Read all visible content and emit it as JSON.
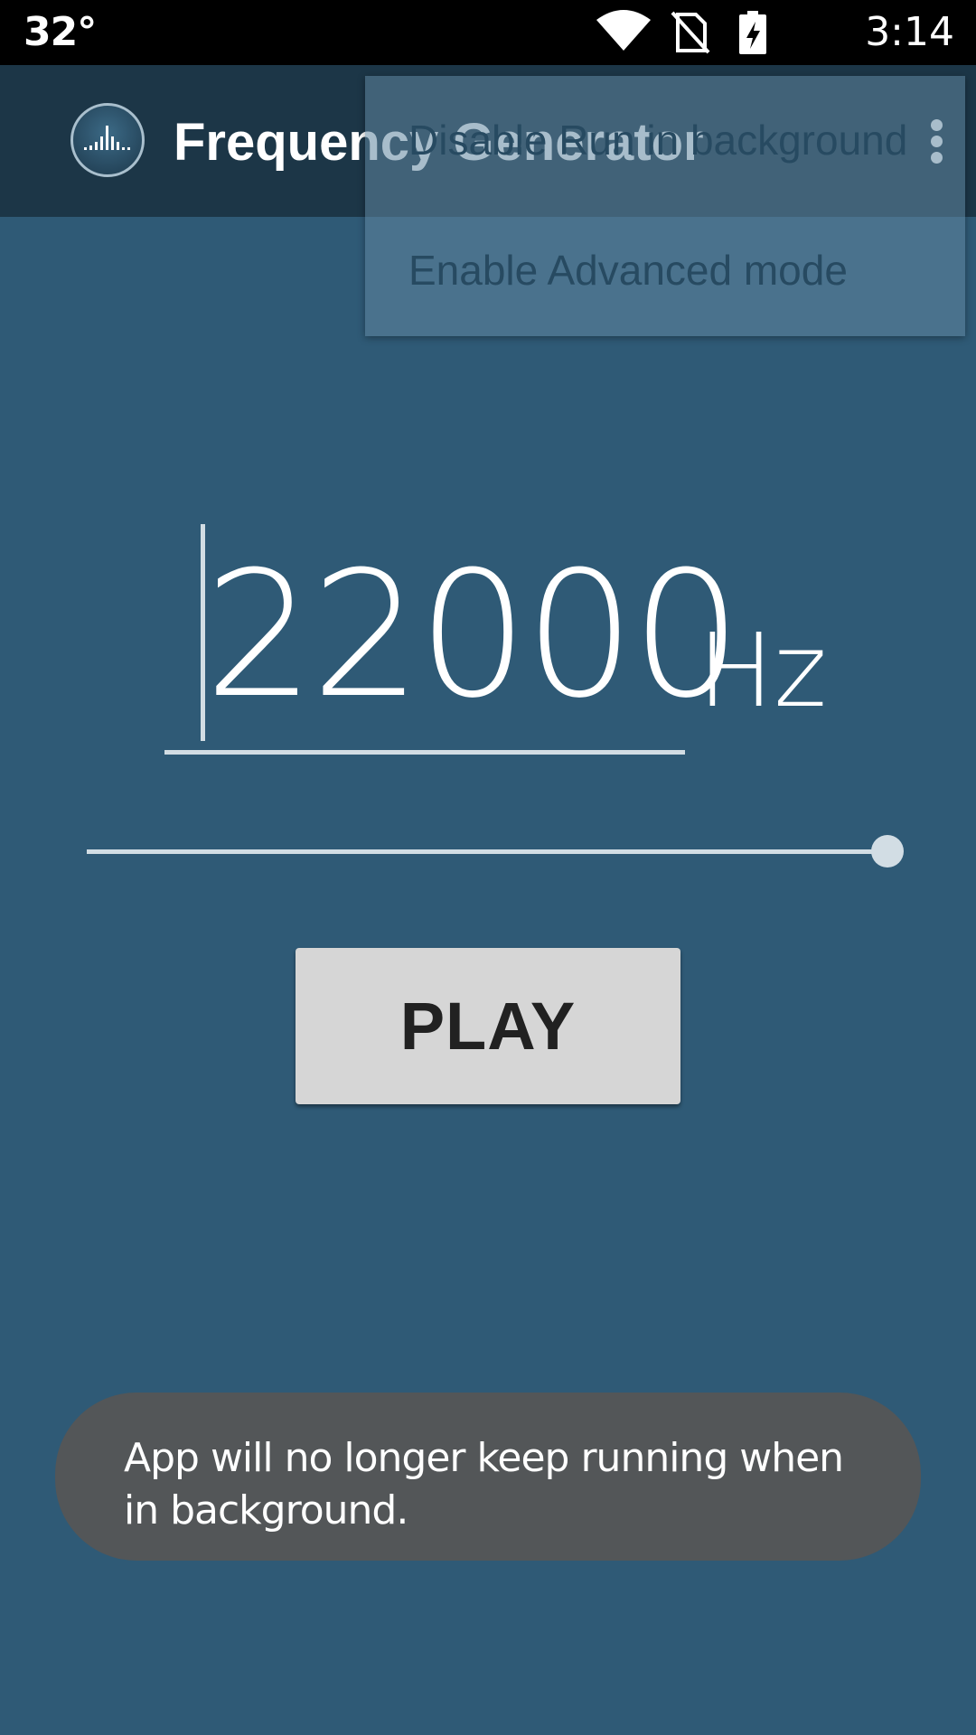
{
  "status_bar": {
    "temperature": "32°",
    "time": "3:14",
    "icons": [
      "wifi-icon",
      "no-sim-icon",
      "battery-charging-icon"
    ]
  },
  "app_bar": {
    "title": "Frequency Generator",
    "logo_icon": "equalizer-logo-icon",
    "overflow_icon": "more-vert-icon"
  },
  "overflow_menu": {
    "items": [
      {
        "label": "Disable Run in background"
      },
      {
        "label": "Enable Advanced mode"
      }
    ]
  },
  "frequency": {
    "value": "22000",
    "unit": "Hz"
  },
  "slider": {
    "fraction": 1.0
  },
  "play_button": {
    "label": "PLAY"
  },
  "toast": {
    "message": "App will no longer keep running when in background."
  },
  "colors": {
    "background": "#2f5a76",
    "app_bar": "#1c3647",
    "accent": "#d2dde4",
    "button": "#d6d6d6",
    "toast": "#535658"
  }
}
